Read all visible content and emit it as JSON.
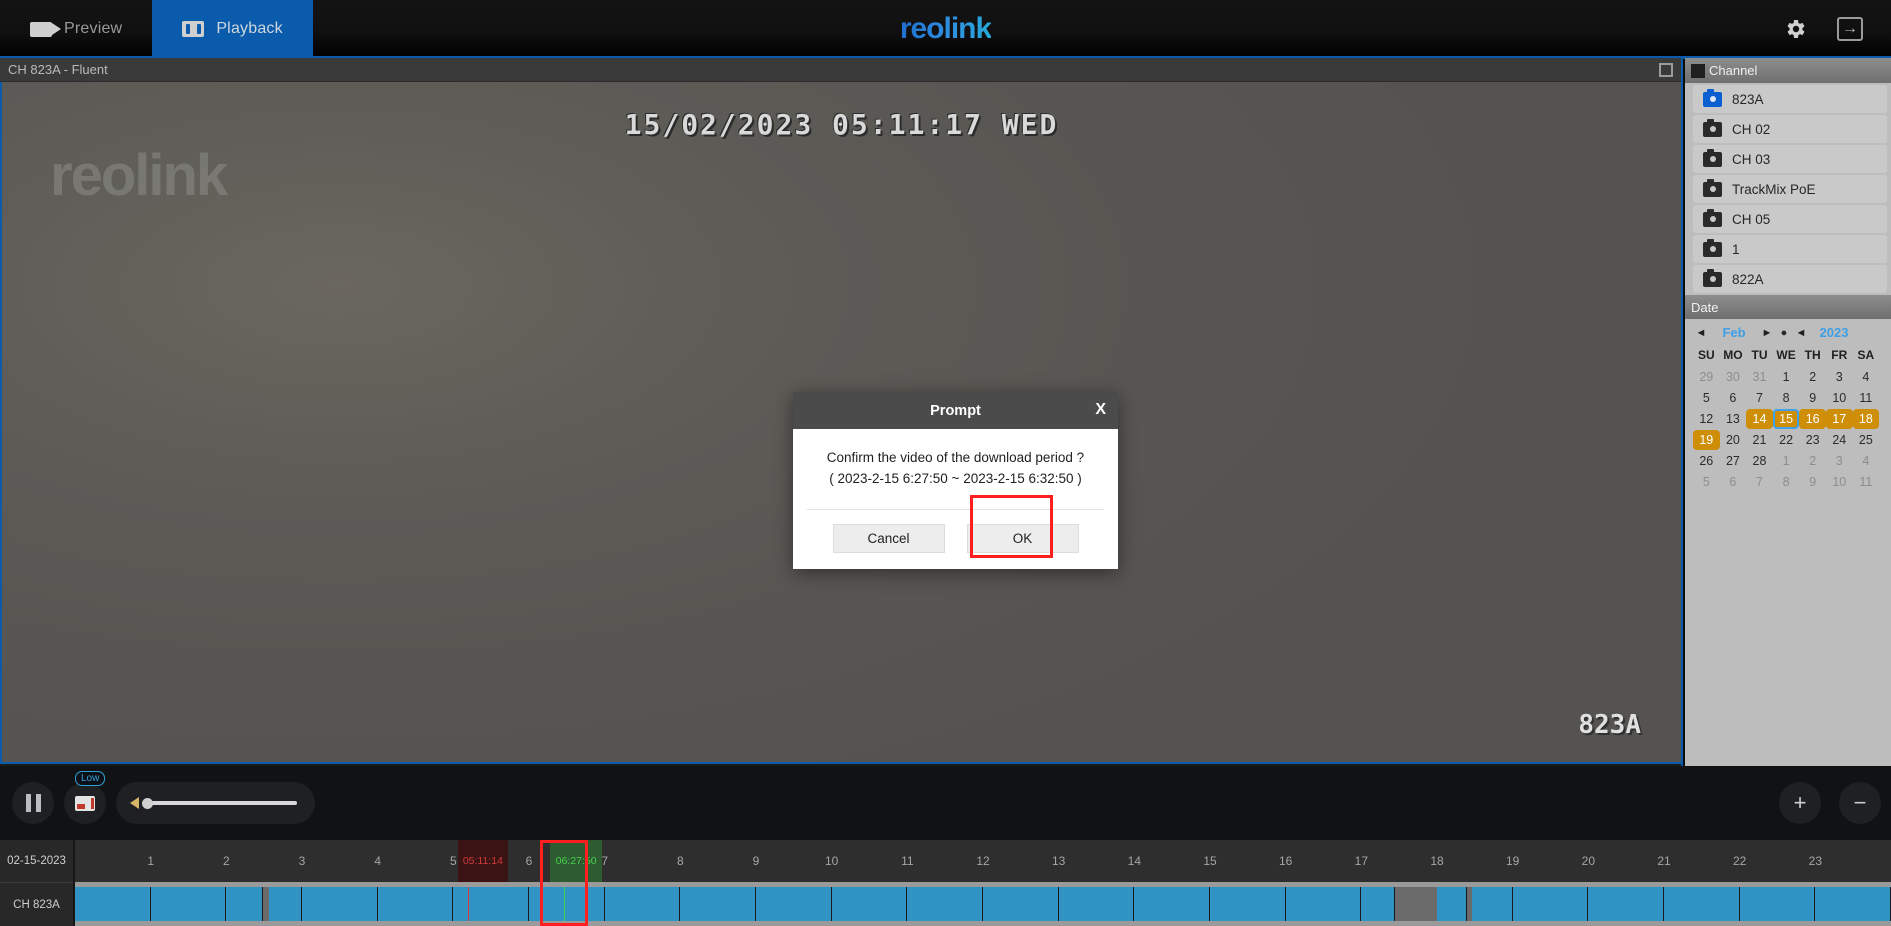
{
  "app": {
    "brand": "reolink",
    "tabs": [
      {
        "label": "Preview",
        "icon": "camcorder-icon",
        "active": false
      },
      {
        "label": "Playback",
        "icon": "film-icon",
        "active": true
      }
    ],
    "settings_icon": "gear-icon",
    "logout_icon": "logout-icon"
  },
  "video": {
    "title": "CH 823A - Fluent",
    "fullscreen_icon": "fullscreen-icon",
    "osd_timestamp": "15/02/2023  05:11:17  WED",
    "osd_watermark": "reolink",
    "osd_channel": "823A"
  },
  "sidebar": {
    "channel_header": "Channel",
    "channels": [
      {
        "label": "823A",
        "active": true
      },
      {
        "label": "CH 02",
        "active": false
      },
      {
        "label": "CH 03",
        "active": false
      },
      {
        "label": "TrackMix PoE",
        "active": false
      },
      {
        "label": "CH 05",
        "active": false
      },
      {
        "label": "1",
        "active": false
      },
      {
        "label": "822A",
        "active": false
      }
    ],
    "date_header": "Date",
    "calendar": {
      "month": "Feb",
      "year": "2023",
      "prev_month_icon": "triangle-left-icon",
      "next_month_icon": "triangle-right-icon",
      "today_dot_icon": "dot-icon",
      "prev_year_icon": "triangle-left-icon",
      "dow": [
        "SU",
        "MO",
        "TU",
        "WE",
        "TH",
        "FR",
        "SA"
      ],
      "weeks": [
        [
          {
            "d": "29",
            "st": "muted"
          },
          {
            "d": "30",
            "st": "muted"
          },
          {
            "d": "31",
            "st": "muted"
          },
          {
            "d": "1",
            "st": ""
          },
          {
            "d": "2",
            "st": ""
          },
          {
            "d": "3",
            "st": ""
          },
          {
            "d": "4",
            "st": ""
          }
        ],
        [
          {
            "d": "5",
            "st": ""
          },
          {
            "d": "6",
            "st": ""
          },
          {
            "d": "7",
            "st": ""
          },
          {
            "d": "8",
            "st": ""
          },
          {
            "d": "9",
            "st": ""
          },
          {
            "d": "10",
            "st": ""
          },
          {
            "d": "11",
            "st": ""
          }
        ],
        [
          {
            "d": "12",
            "st": ""
          },
          {
            "d": "13",
            "st": ""
          },
          {
            "d": "14",
            "st": "rec"
          },
          {
            "d": "15",
            "st": "sel"
          },
          {
            "d": "16",
            "st": "rec"
          },
          {
            "d": "17",
            "st": "rec"
          },
          {
            "d": "18",
            "st": "rec"
          }
        ],
        [
          {
            "d": "19",
            "st": "rec"
          },
          {
            "d": "20",
            "st": ""
          },
          {
            "d": "21",
            "st": ""
          },
          {
            "d": "22",
            "st": ""
          },
          {
            "d": "23",
            "st": ""
          },
          {
            "d": "24",
            "st": ""
          },
          {
            "d": "25",
            "st": ""
          }
        ],
        [
          {
            "d": "26",
            "st": ""
          },
          {
            "d": "27",
            "st": ""
          },
          {
            "d": "28",
            "st": ""
          },
          {
            "d": "1",
            "st": "muted"
          },
          {
            "d": "2",
            "st": "muted"
          },
          {
            "d": "3",
            "st": "muted"
          },
          {
            "d": "4",
            "st": "muted"
          }
        ],
        [
          {
            "d": "5",
            "st": "muted"
          },
          {
            "d": "6",
            "st": "muted"
          },
          {
            "d": "7",
            "st": "muted"
          },
          {
            "d": "8",
            "st": "muted"
          },
          {
            "d": "9",
            "st": "muted"
          },
          {
            "d": "10",
            "st": "muted"
          },
          {
            "d": "11",
            "st": "muted"
          }
        ]
      ]
    }
  },
  "controls": {
    "pause_icon": "pause-icon",
    "stream_icon": "stream-quality-icon",
    "quality_badge": "Low",
    "volume_icon": "speaker-icon",
    "volume_value": 0,
    "zoom_in_icon": "plus-icon",
    "zoom_out_icon": "minus-icon"
  },
  "timeline": {
    "date_label": "02-15-2023",
    "channel_label": "CH 823A",
    "hours": [
      "1",
      "2",
      "3",
      "4",
      "5",
      "6",
      "7",
      "8",
      "9",
      "10",
      "11",
      "12",
      "13",
      "14",
      "15",
      "16",
      "17",
      "18",
      "19",
      "20",
      "21",
      "22",
      "23"
    ],
    "cursor_time": "05:11:14",
    "selection_time": "06:27:50",
    "selection_start": "6:27:50",
    "selection_end": "6:32:50",
    "colors": {
      "recording": "#2f93c4",
      "cursor": "#d63a3a",
      "selection": "#3ad64c",
      "selection_box": "#ff1f1f"
    }
  },
  "dialog": {
    "title": "Prompt",
    "close_label": "X",
    "message_line1": "Confirm the video of the download period ?",
    "message_line2": "( 2023-2-15 6:27:50 ~ 2023-2-15 6:32:50 )",
    "cancel_label": "Cancel",
    "ok_label": "OK"
  }
}
